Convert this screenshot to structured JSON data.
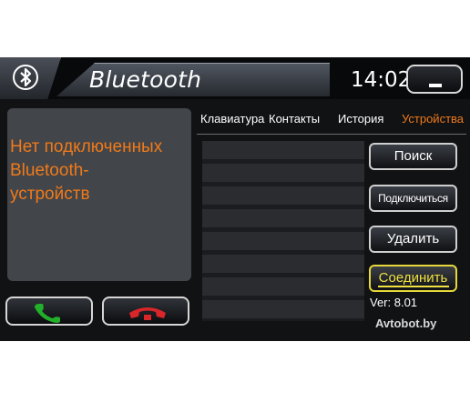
{
  "header": {
    "title": "Bluetooth",
    "clock": "14:02"
  },
  "status": {
    "line1": "Нет подключенных",
    "line2": "Bluetooth-",
    "line3": "устройств"
  },
  "tabs": [
    {
      "label": "Клавиатура"
    },
    {
      "label": "Контакты"
    },
    {
      "label": "История"
    },
    {
      "label": "Устройства",
      "active": true
    }
  ],
  "actions": {
    "search": "Поиск",
    "connect": "Подключиться",
    "delete": "Удалить",
    "pair": "Соединить"
  },
  "version": "Ver: 8.01",
  "watermark": "Avtobot.by",
  "colors": {
    "accent": "#f07a1a",
    "highlight": "#f0e040",
    "accept": "#22b02a",
    "reject": "#d8262a"
  }
}
